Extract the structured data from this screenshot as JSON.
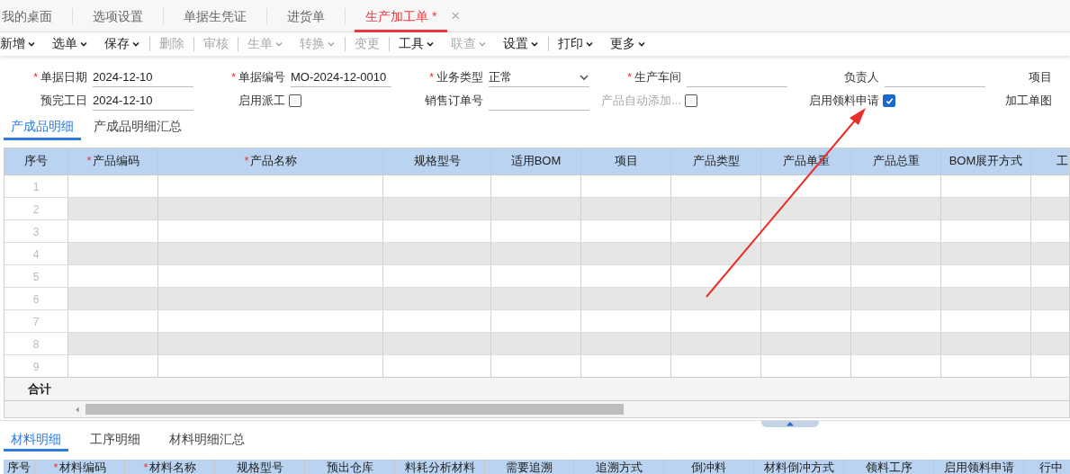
{
  "tabs": [
    {
      "label": "我的桌面",
      "selected": false
    },
    {
      "label": "选项设置",
      "selected": false
    },
    {
      "label": "单据生凭证",
      "selected": false
    },
    {
      "label": "进货单",
      "selected": false
    },
    {
      "label": "生产加工单 *",
      "selected": true,
      "close": "×"
    }
  ],
  "toolbar": [
    {
      "label": "新增",
      "dropdown": true,
      "disabled": false,
      "divider": false
    },
    {
      "label": "选单",
      "dropdown": true,
      "disabled": false,
      "divider": false
    },
    {
      "label": "保存",
      "dropdown": true,
      "disabled": false,
      "divider": false
    },
    {
      "label": "删除",
      "dropdown": false,
      "disabled": true,
      "divider": true
    },
    {
      "label": "审核",
      "dropdown": false,
      "disabled": true,
      "divider": true
    },
    {
      "label": "生单",
      "dropdown": true,
      "disabled": true,
      "divider": true
    },
    {
      "label": "转换",
      "dropdown": true,
      "disabled": true,
      "divider": false
    },
    {
      "label": "变更",
      "dropdown": false,
      "disabled": true,
      "divider": true
    },
    {
      "label": "工具",
      "dropdown": true,
      "disabled": false,
      "divider": true
    },
    {
      "label": "联查",
      "dropdown": true,
      "disabled": true,
      "divider": false
    },
    {
      "label": "设置",
      "dropdown": true,
      "disabled": false,
      "divider": false
    },
    {
      "label": "打印",
      "dropdown": true,
      "disabled": false,
      "divider": true
    },
    {
      "label": "更多",
      "dropdown": true,
      "disabled": false,
      "divider": false
    }
  ],
  "form": {
    "rows": [
      [
        {
          "kind": "text",
          "mark": "*",
          "label": "单据日期",
          "value": "2024-12-10"
        },
        {
          "kind": "text",
          "mark": "*",
          "label": "单据编号",
          "value": "MO-2024-12-0010"
        },
        {
          "kind": "select",
          "mark": "*",
          "label": "业务类型",
          "value": "正常"
        },
        {
          "kind": "text",
          "mark": "*",
          "label": "生产车间"
        },
        {
          "kind": "text",
          "label": "负责人"
        },
        {
          "kind": "label",
          "label": "项目"
        }
      ],
      [
        {
          "kind": "text",
          "label": "预完工日",
          "value": "2024-12-10"
        },
        {
          "kind": "checkbox",
          "label": "启用派工",
          "checked": false,
          "disabled": false
        },
        {
          "kind": "text",
          "label": "销售订单号"
        },
        {
          "kind": "checkbox",
          "label": "产品自动添加...",
          "checked": false,
          "disabled": true
        },
        {
          "kind": "checkbox",
          "label": "启用领料申请",
          "checked": true,
          "disabled": false
        },
        {
          "kind": "label",
          "label": "加工单图"
        }
      ]
    ]
  },
  "product_tabs": [
    {
      "label": "产成品明细",
      "selected": true
    },
    {
      "label": "产成品明细汇总",
      "selected": false
    }
  ],
  "product_table": {
    "columns": [
      {
        "label": "序号"
      },
      {
        "mark": "*",
        "label": "产品编码"
      },
      {
        "mark": "*",
        "label": "产品名称"
      },
      {
        "label": "规格型号"
      },
      {
        "label": "适用BOM"
      },
      {
        "label": "项目"
      },
      {
        "label": "产品类型"
      },
      {
        "label": "产品单重"
      },
      {
        "label": "产品总重"
      },
      {
        "label": "BOM展开方式"
      },
      {
        "label": "工"
      }
    ],
    "rows": [
      "1",
      "2",
      "3",
      "4",
      "5",
      "6",
      "7",
      "8",
      "9"
    ],
    "total_label": "合计"
  },
  "material_tabs": [
    {
      "label": "材料明细",
      "selected": true
    },
    {
      "label": "工序明细",
      "selected": false
    },
    {
      "label": "材料明细汇总",
      "selected": false
    }
  ],
  "material_table": {
    "columns": [
      {
        "label": "序号"
      },
      {
        "mark": "*",
        "label": "材料编码"
      },
      {
        "mark": "*",
        "label": "材料名称"
      },
      {
        "label": "规格型号"
      },
      {
        "label": "预出仓库"
      },
      {
        "label": "料耗分析材料"
      },
      {
        "label": "需要追溯"
      },
      {
        "label": "追溯方式"
      },
      {
        "label": "倒冲料"
      },
      {
        "label": "材料倒冲方式"
      },
      {
        "label": "领料工序"
      },
      {
        "label": "启用领料申请"
      },
      {
        "label": "行中"
      }
    ]
  }
}
